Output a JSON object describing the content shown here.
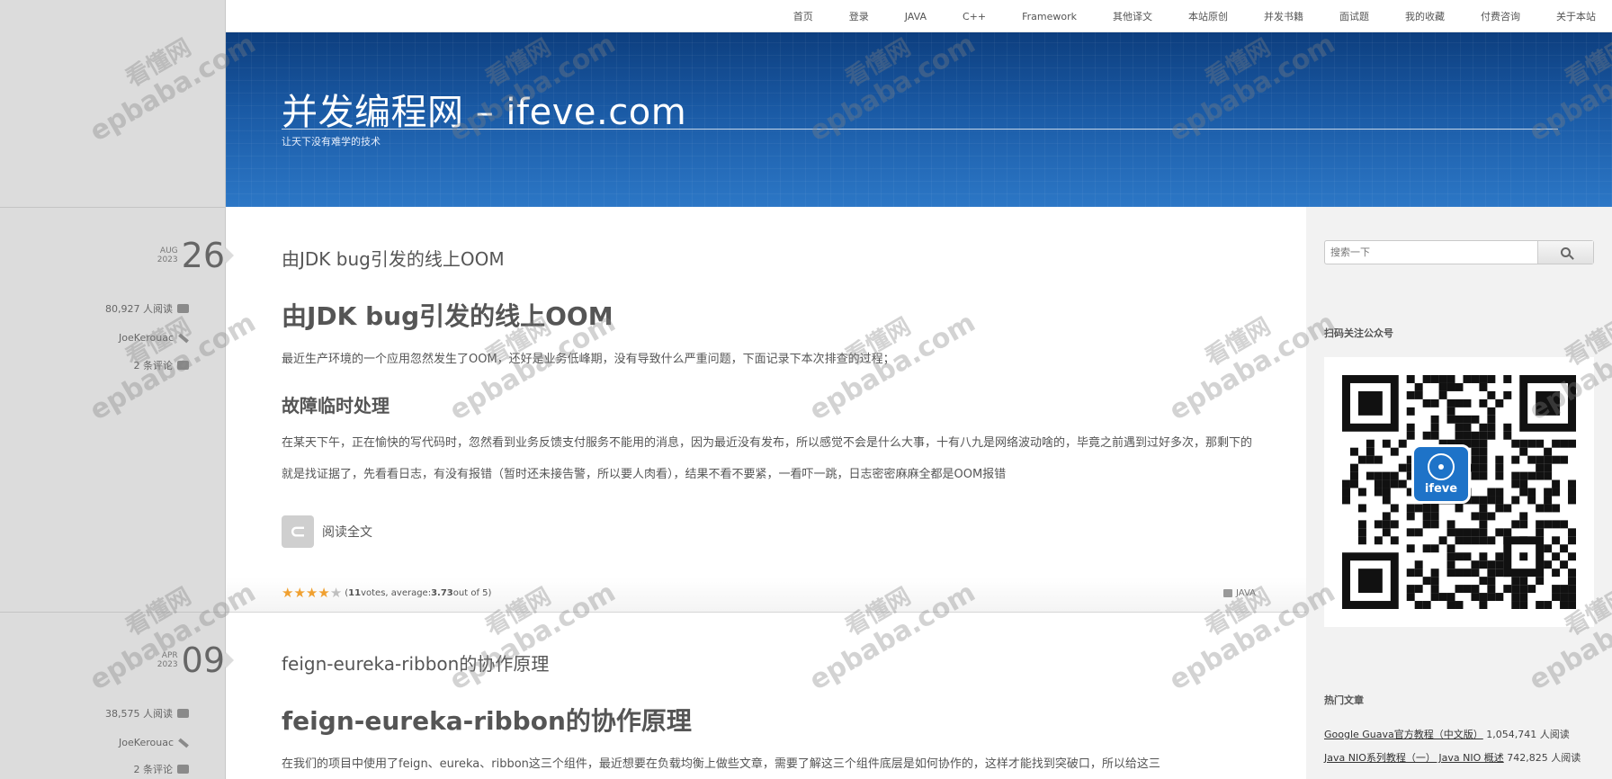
{
  "nav": {
    "items": [
      "首页",
      "登录",
      "JAVA",
      "C++",
      "Framework",
      "其他译文",
      "本站原创",
      "并发书籍",
      "面试题",
      "我的收藏",
      "付费咨询",
      "关于本站"
    ]
  },
  "banner": {
    "title": "并发编程网 – ifeve.com",
    "tagline": "让天下没有难学的技术"
  },
  "posts": [
    {
      "month": "AUG",
      "year": "2023",
      "day": "26",
      "views": "80,927 人阅读",
      "author": "JoeKerouac",
      "comments": "2 条评论",
      "title_small": "由JDK bug引发的线上OOM",
      "heading": "由JDK bug引发的线上OOM",
      "intro": "最近生产环境的一个应用忽然发生了OOM，还好是业务低峰期，没有导致什么严重问题，下面记录下本次排查的过程；",
      "subheading": "故障临时处理",
      "body": "在某天下午，正在愉快的写代码时，忽然看到业务反馈支付服务不能用的消息，因为最近没有发布，所以感觉不会是什么大事，十有八九是网络波动啥的，毕竟之前遇到过好多次，那剩下的就是找证据了，先看看日志，有没有报错（暂时还未接告警，所以要人肉看），结果不看不要紧，一看吓一跳，日志密密麻麻全都是OOM报错",
      "read_more": "阅读全文",
      "rating_votes": "11",
      "rating_avg": "3.73",
      "rating_pre": "(",
      "rating_mid1": " votes, average: ",
      "rating_mid2": " out of 5)",
      "rating_value": 3.73,
      "category": "JAVA"
    },
    {
      "month": "APR",
      "year": "2023",
      "day": "09",
      "views": "38,575 人阅读",
      "author": "JoeKerouac",
      "comments": "2 条评论",
      "title_small": "feign-eureka-ribbon的协作原理",
      "heading": "feign-eureka-ribbon的协作原理",
      "intro": "在我们的项目中使用了feign、eureka、ribbon这三个组件，最近想要在负载均衡上做些文章，需要了解这三个组件底层是如何协作的，这样才能找到突破口，所以给这三"
    }
  ],
  "sidebar": {
    "search_placeholder": "搜索一下",
    "qr_title": "扫码关注公众号",
    "qr_label": "ifeve",
    "hot_title": "热门文章",
    "hot": [
      {
        "title": "Google Guava官方教程（中文版）",
        "views": "1,054,741 人阅读"
      },
      {
        "title": "Java NIO系列教程（一） Java NIO 概述",
        "views": "742,825 人阅读"
      }
    ]
  },
  "watermark": {
    "line1": "看懂网",
    "line2": "epbaba.com"
  }
}
